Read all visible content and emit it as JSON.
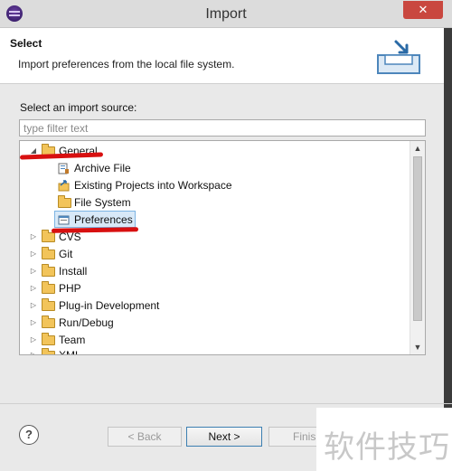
{
  "window": {
    "title": "Import",
    "close_label": "✕"
  },
  "header": {
    "title": "Select",
    "description": "Import preferences from the local file system.",
    "image_icon": "import-wizard-icon"
  },
  "source": {
    "label": "Select an import source:",
    "filter_placeholder": "type filter text",
    "filter_value": ""
  },
  "tree": {
    "items": [
      {
        "label": "General",
        "level": 0,
        "expanded": true,
        "icon": "folder-open-icon"
      },
      {
        "label": "Archive File",
        "level": 1,
        "icon": "archive-file-icon"
      },
      {
        "label": "Existing Projects into Workspace",
        "level": 1,
        "icon": "existing-projects-icon"
      },
      {
        "label": "File System",
        "level": 1,
        "icon": "folder-icon"
      },
      {
        "label": "Preferences",
        "level": 1,
        "icon": "preferences-icon",
        "selected": true
      },
      {
        "label": "CVS",
        "level": 0,
        "expanded": false,
        "icon": "folder-icon"
      },
      {
        "label": "Git",
        "level": 0,
        "expanded": false,
        "icon": "folder-icon"
      },
      {
        "label": "Install",
        "level": 0,
        "expanded": false,
        "icon": "folder-icon"
      },
      {
        "label": "PHP",
        "level": 0,
        "expanded": false,
        "icon": "folder-icon"
      },
      {
        "label": "Plug-in Development",
        "level": 0,
        "expanded": false,
        "icon": "folder-icon"
      },
      {
        "label": "Run/Debug",
        "level": 0,
        "expanded": false,
        "icon": "folder-icon"
      },
      {
        "label": "Team",
        "level": 0,
        "expanded": false,
        "icon": "folder-icon"
      },
      {
        "label": "XML",
        "level": 0,
        "expanded": false,
        "icon": "folder-icon"
      }
    ]
  },
  "buttons": {
    "help": "?",
    "back": "< Back",
    "next": "Next >",
    "finish": "Finish"
  },
  "watermark": {
    "text": "软件技巧"
  },
  "colors": {
    "annotation": "#d81010",
    "selection": "#d8e9f8"
  }
}
